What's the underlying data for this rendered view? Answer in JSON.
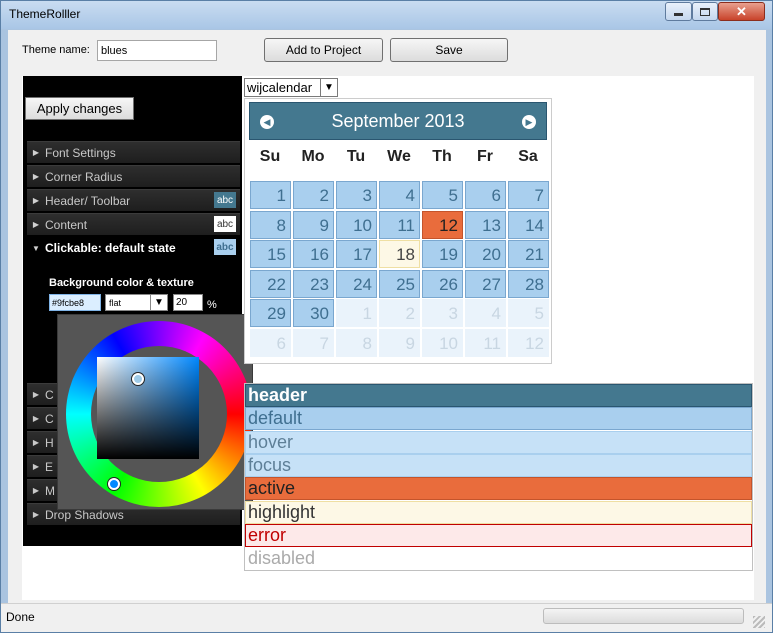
{
  "window": {
    "title": "ThemeRolller"
  },
  "toolbar": {
    "theme_name_label": "Theme name:",
    "theme_name_value": "blues",
    "add_label": "Add to Project",
    "save_label": "Save"
  },
  "panel": {
    "apply_label": "Apply changes",
    "sections": [
      {
        "label": "Font Settings"
      },
      {
        "label": "Corner Radius"
      },
      {
        "label": "Header/ Toolbar",
        "swatch": "abc"
      },
      {
        "label": "Content",
        "swatch": "abc"
      },
      {
        "label": "Clickable: default state",
        "swatch": "abc"
      }
    ],
    "lower_sections": [
      {
        "label": "C"
      },
      {
        "label": "C"
      },
      {
        "label": "H"
      },
      {
        "label": "E"
      },
      {
        "label": "M"
      },
      {
        "label": "Drop Shadows"
      }
    ],
    "background": {
      "label": "Background color & texture",
      "hex_value": "#9fcbe8",
      "texture": "flat",
      "opacity": "20",
      "percent": "%"
    }
  },
  "calendar": {
    "widget_select": "wijcalendar",
    "title": "September 2013",
    "weekdays": [
      "Su",
      "Mo",
      "Tu",
      "We",
      "Th",
      "Fr",
      "Sa"
    ],
    "days": [
      [
        "1",
        "2",
        "3",
        "4",
        "5",
        "6",
        "7"
      ],
      [
        "8",
        "9",
        "10",
        "11",
        "12",
        "13",
        "14"
      ],
      [
        "15",
        "16",
        "17",
        "18",
        "19",
        "20",
        "21"
      ],
      [
        "22",
        "23",
        "24",
        "25",
        "26",
        "27",
        "28"
      ],
      [
        "29",
        "30",
        "1",
        "2",
        "3",
        "4",
        "5"
      ],
      [
        "6",
        "7",
        "8",
        "9",
        "10",
        "11",
        "12"
      ]
    ]
  },
  "states": [
    "header",
    "default",
    "hover",
    "focus",
    "active",
    "highlight",
    "error",
    "disabled"
  ],
  "statusbar": {
    "text": "Done"
  },
  "colors": {
    "header": "#44788f",
    "default": "#a9cfee",
    "hover": "#c6e1f7",
    "active": "#e96c3c",
    "highlight": "#fdf8e6",
    "error": "#fde9e9"
  }
}
